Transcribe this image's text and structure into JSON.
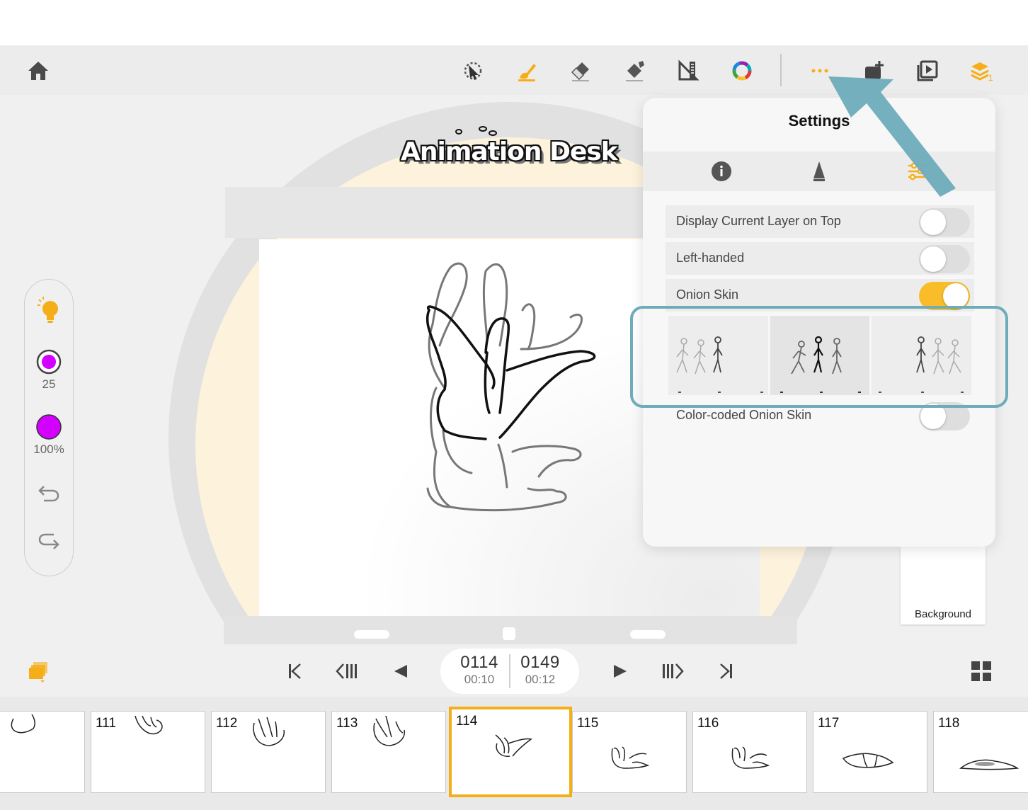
{
  "app": {
    "logo_text": "Animation Desk"
  },
  "toolbar": {
    "home": "house-icon",
    "tools": [
      {
        "name": "select",
        "icon": "lasso-select-icon"
      },
      {
        "name": "brush",
        "icon": "brush-icon"
      },
      {
        "name": "eraser",
        "icon": "eraser-icon"
      },
      {
        "name": "fill",
        "icon": "paint-bucket-icon"
      },
      {
        "name": "ruler",
        "icon": "ruler-icon"
      },
      {
        "name": "color",
        "icon": "color-wheel-icon"
      }
    ],
    "more": "more-dots-icon",
    "add_frame": "add-frame-icon",
    "preview": "preview-play-icon",
    "layers": {
      "icon": "layers-icon",
      "count": "1"
    },
    "accent_color": "#f5ae18"
  },
  "left_panel": {
    "brush_size": "25",
    "opacity": "100%",
    "brush_color": "#d400ff"
  },
  "settings": {
    "title": "Settings",
    "tabs": [
      "info-icon",
      "pen-nib-icon",
      "sliders-icon"
    ],
    "rows": [
      {
        "label": "Display Current Layer on Top",
        "on": false
      },
      {
        "label": "Left-handed",
        "on": false
      },
      {
        "label": "Onion Skin",
        "on": true
      },
      {
        "label": "Color-coded Onion Skin",
        "on": false
      }
    ]
  },
  "layers_panel": {
    "background_label": "Background"
  },
  "transport": {
    "current_frame": "0114",
    "current_time": "00:10",
    "total_frames": "0149",
    "total_time": "00:12"
  },
  "filmstrip": {
    "frames": [
      "",
      "111",
      "112",
      "113",
      "114",
      "115",
      "116",
      "117",
      "118"
    ],
    "current": "114"
  }
}
